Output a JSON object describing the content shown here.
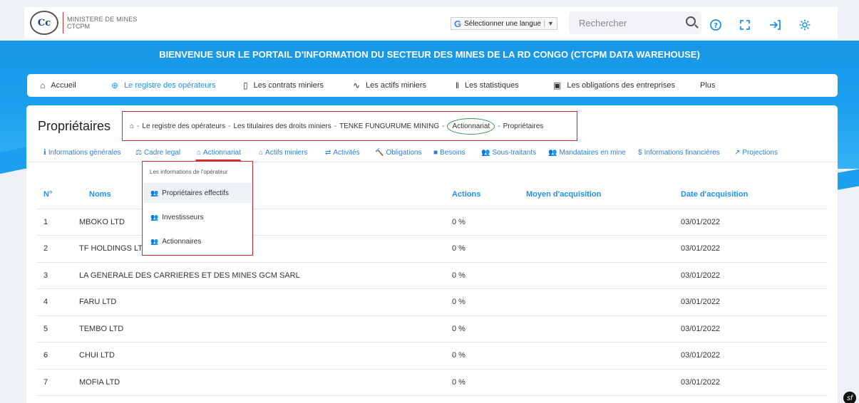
{
  "header": {
    "logo_text": "CTCPM logo",
    "brand_line1": "MINISTERE DE MINES",
    "brand_line2": "CTCPM",
    "language_select": "Sélectionner une langue",
    "search_placeholder": "Rechercher"
  },
  "banner": {
    "title": "BIENVENUE SUR LE PORTAIL D'INFORMATION DU SECTEUR DES MINES DE LA RD CONGO (CTCPM DATA WAREHOUSE)"
  },
  "nav": {
    "items": [
      {
        "label": "Accueil",
        "icon": "home-icon"
      },
      {
        "label": "Le registre des opérateurs",
        "icon": "globe-icon"
      },
      {
        "label": "Les contrats miniers",
        "icon": "file-icon"
      },
      {
        "label": "Les actifs miniers",
        "icon": "activity-icon"
      },
      {
        "label": "Les statistiques",
        "icon": "bar-chart-icon"
      },
      {
        "label": "Les obligations des entreprises",
        "icon": "layout-icon"
      },
      {
        "label": "Plus",
        "icon": ""
      }
    ]
  },
  "page": {
    "title": "Propriétaires",
    "breadcrumb": [
      "Le registre des opérateurs",
      "Les titulaires des droits miniers",
      "TENKE FUNGURUME MINING",
      "Actionnariat",
      "Propriétaires"
    ]
  },
  "tabs": [
    {
      "label": "Informations générales",
      "icon": "info-icon"
    },
    {
      "label": "Cadre legal",
      "icon": "scale-icon"
    },
    {
      "label": "Actionnariat",
      "icon": "bank-icon"
    },
    {
      "label": "Actifs miniers",
      "icon": "bank-icon"
    },
    {
      "label": "Activités",
      "icon": "exchange-icon"
    },
    {
      "label": "Obligations",
      "icon": "gavel-icon"
    },
    {
      "label": "Besoins",
      "icon": "square-icon"
    },
    {
      "label": "Sous-traitants",
      "icon": "users-icon"
    },
    {
      "label": "Mandataires en mine",
      "icon": "users-icon"
    },
    {
      "label": "Informations financières",
      "icon": "dollar-icon"
    },
    {
      "label": "Projections",
      "icon": "line-chart-icon"
    }
  ],
  "dropdown": {
    "header": "Les informations de l'opérateur",
    "options": [
      "Propriétaires effectifs",
      "Investisseurs",
      "Actionnaires"
    ]
  },
  "table": {
    "headers": [
      "N°",
      "Noms",
      "Actions",
      "Moyen d'acquisition",
      "Date d'acquisition"
    ],
    "rows": [
      {
        "n": "1",
        "nom": "MBOKO LTD",
        "actions": "0 %",
        "moyen": "",
        "date": "03/01/2022"
      },
      {
        "n": "2",
        "nom": "TF HOLDINGS LTD",
        "actions": "0 %",
        "moyen": "",
        "date": "03/01/2022"
      },
      {
        "n": "3",
        "nom": "LA GENERALE DES CARRIERES ET DES MINES GCM SARL",
        "actions": "0 %",
        "moyen": "",
        "date": "03/01/2022"
      },
      {
        "n": "4",
        "nom": "FARU LTD",
        "actions": "0 %",
        "moyen": "",
        "date": "03/01/2022"
      },
      {
        "n": "5",
        "nom": "TEMBO LTD",
        "actions": "0 %",
        "moyen": "",
        "date": "03/01/2022"
      },
      {
        "n": "6",
        "nom": "CHUI LTD",
        "actions": "0 %",
        "moyen": "",
        "date": "03/01/2022"
      },
      {
        "n": "7",
        "nom": "MOFIA LTD",
        "actions": "0 %",
        "moyen": "",
        "date": "03/01/2022"
      }
    ]
  },
  "colors": {
    "accent": "#1d8ff0",
    "banner": "#1aa0ee",
    "highlight_border": "#d12a2a"
  }
}
